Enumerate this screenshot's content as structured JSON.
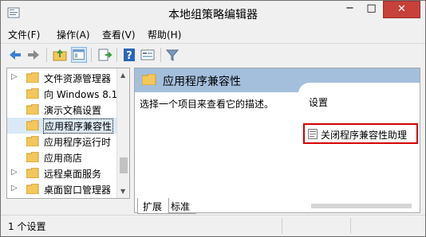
{
  "window": {
    "title": "本地组策略编辑器",
    "controls": {
      "minimize": "−",
      "maximize": "□",
      "close": "✕"
    }
  },
  "menu": [
    {
      "label": "文件(F)"
    },
    {
      "label": "操作(A)"
    },
    {
      "label": "查看(V)"
    },
    {
      "label": "帮助(H)"
    }
  ],
  "toolbar": {
    "icons": [
      "back-arrow-icon",
      "forward-arrow-icon",
      "up-folder-icon",
      "show-hide-tree-icon",
      "export-list-icon",
      "help-icon",
      "properties-icon",
      "filter-icon"
    ]
  },
  "tree": {
    "items": [
      {
        "label": "文件资源管理器",
        "expandable": true,
        "selected": false
      },
      {
        "label": "向 Windows 8.1",
        "expandable": false,
        "selected": false
      },
      {
        "label": "演示文稿设置",
        "expandable": false,
        "selected": false
      },
      {
        "label": "应用程序兼容性",
        "expandable": false,
        "selected": true
      },
      {
        "label": "应用程序运行时",
        "expandable": false,
        "selected": false
      },
      {
        "label": "应用商店",
        "expandable": false,
        "selected": false
      },
      {
        "label": "远程桌面服务",
        "expandable": true,
        "selected": false
      },
      {
        "label": "桌面窗口管理器",
        "expandable": true,
        "selected": false
      }
    ]
  },
  "main": {
    "header_title": "应用程序兼容性",
    "description": "选择一个项目来查看它的描述。",
    "list_header": "设置",
    "items": [
      {
        "label": "关闭程序兼容性助理"
      }
    ]
  },
  "tabs": [
    {
      "label": "扩展"
    },
    {
      "label": "标准"
    }
  ],
  "status": {
    "text": "1 个设置"
  },
  "colors": {
    "header_band": "#a4bfdc",
    "close_button": "#c7403a",
    "highlight_border": "#d40000",
    "folder": "#f3c75a"
  }
}
